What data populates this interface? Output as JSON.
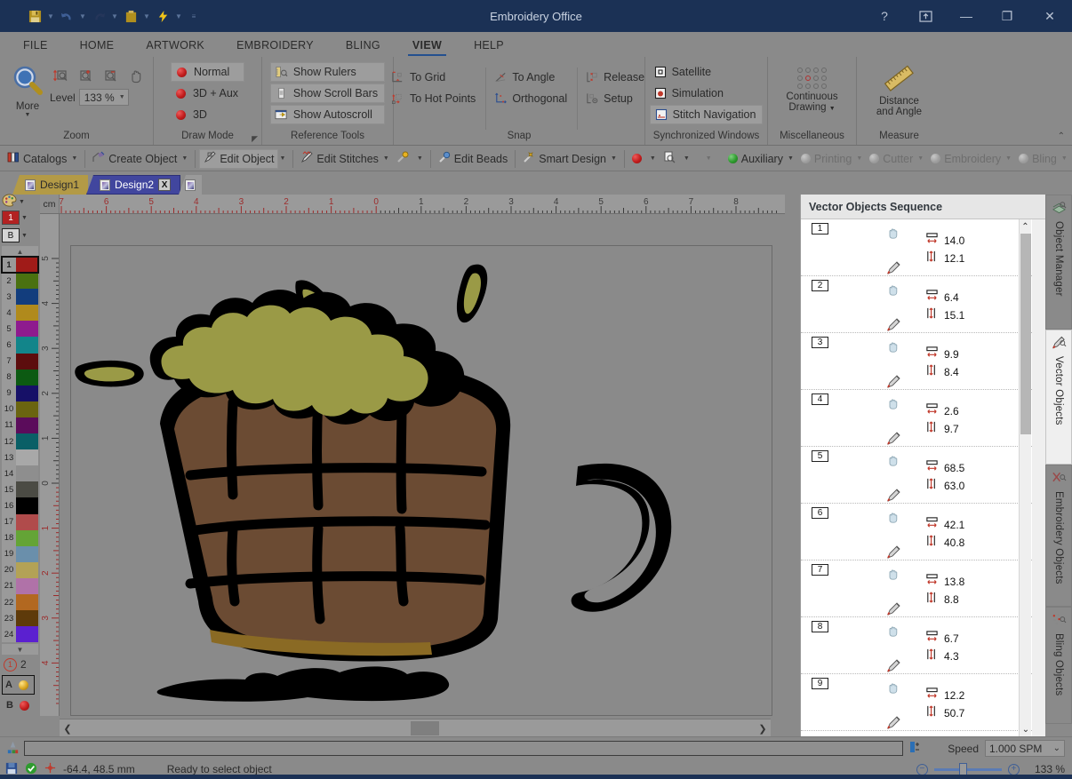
{
  "window": {
    "title": "Embroidery Office",
    "quick_access": [
      "save-icon",
      "undo-icon",
      "redo-icon",
      "clipboard-icon",
      "lightning-icon",
      "more-commands-icon"
    ],
    "buttons": {
      "help": "?",
      "ribbon_display": "⬆",
      "minimize": "—",
      "maximize": "❐",
      "close": "✕"
    }
  },
  "ribbon": {
    "tabs": [
      {
        "label": "FILE",
        "active": false
      },
      {
        "label": "HOME",
        "active": false
      },
      {
        "label": "ARTWORK",
        "active": false
      },
      {
        "label": "EMBROIDERY",
        "active": false
      },
      {
        "label": "BLING",
        "active": false
      },
      {
        "label": "VIEW",
        "active": true
      },
      {
        "label": "HELP",
        "active": false
      }
    ],
    "groups": [
      {
        "name": "Zoom",
        "label": "Zoom",
        "big_button": {
          "label": "More",
          "icon": "magnifier-icon"
        },
        "small_buttons": [
          "zoom-fit-height-icon",
          "zoom-in-icon",
          "zoom-out-icon",
          "pan-hand-icon"
        ],
        "level_label": "Level",
        "level_value": "133 %"
      },
      {
        "name": "DrawMode",
        "label": "Draw Mode",
        "items": [
          {
            "label": "Normal",
            "selected": true
          },
          {
            "label": "3D + Aux",
            "selected": false
          },
          {
            "label": "3D",
            "selected": false
          }
        ],
        "has_dialog_launcher": true
      },
      {
        "name": "ReferenceTools",
        "label": "Reference Tools",
        "items": [
          {
            "label": "Show Rulers",
            "selected": true
          },
          {
            "label": "Show Scroll Bars",
            "selected": true
          },
          {
            "label": "Show Autoscroll",
            "selected": true
          }
        ]
      },
      {
        "name": "Snap",
        "label": "Snap",
        "col1": [
          {
            "label": "To Grid"
          },
          {
            "label": "To Hot Points"
          }
        ],
        "col2": [
          {
            "label": "To Angle"
          },
          {
            "label": "Orthogonal"
          }
        ],
        "col3": [
          {
            "label": "Release"
          },
          {
            "label": "Setup"
          }
        ]
      },
      {
        "name": "SynchronizedWindows",
        "label": "Synchronized Windows",
        "items": [
          {
            "label": "Satellite",
            "selected": false
          },
          {
            "label": "Simulation",
            "selected": false
          },
          {
            "label": "Stitch Navigation",
            "selected": true
          }
        ]
      },
      {
        "name": "Miscellaneous",
        "label": "Miscellaneous",
        "big_button": {
          "label_line1": "Continuous",
          "label_line2": "Drawing",
          "icon": "dot-grid-icon"
        }
      },
      {
        "name": "Measure",
        "label": "Measure",
        "big_button": {
          "label_line1": "Distance",
          "label_line2": "and Angle",
          "icon": "ruler-icon"
        }
      }
    ],
    "collapse_icon": "chevron-up-icon"
  },
  "toolbar2": {
    "items": [
      {
        "label": "Catalogs",
        "icon": "catalogs-icon",
        "arrow": true,
        "selected": false,
        "dim": false
      },
      {
        "label": "Create Object",
        "icon": "create-object-icon",
        "arrow": true,
        "selected": false,
        "dim": false
      },
      {
        "label": "Edit Object",
        "icon": "edit-object-icon",
        "arrow": true,
        "selected": true,
        "dim": false
      },
      {
        "label": "Edit Stitches",
        "icon": "edit-stitches-icon",
        "arrow": true,
        "selected": false,
        "dim": false
      },
      {
        "label": "",
        "icon": "magic-wand-icon",
        "arrow": true,
        "selected": false,
        "dim": false
      },
      {
        "label": "Edit Beads",
        "icon": "edit-beads-icon",
        "arrow": false,
        "selected": false,
        "dim": false
      },
      {
        "label": "Smart Design",
        "icon": "smart-design-icon",
        "arrow": true,
        "selected": false,
        "dim": false
      },
      {
        "label": "",
        "icon": "red-ball-icon",
        "arrow": true,
        "selected": false,
        "dim": false
      },
      {
        "label": "",
        "icon": "inspect-icon",
        "arrow": true,
        "selected": false,
        "dim": false
      },
      {
        "label": "",
        "icon": "blank-icon",
        "arrow": true,
        "selected": false,
        "dim": true
      },
      {
        "label": "Auxiliary",
        "icon": "green-ball-icon",
        "arrow": true,
        "selected": false,
        "dim": false
      },
      {
        "label": "Printing",
        "icon": "grey-ball-icon",
        "arrow": true,
        "selected": false,
        "dim": true
      },
      {
        "label": "Cutter",
        "icon": "grey-ball-icon",
        "arrow": true,
        "selected": false,
        "dim": true
      },
      {
        "label": "Embroidery",
        "icon": "grey-ball-icon",
        "arrow": true,
        "selected": false,
        "dim": true
      },
      {
        "label": "Bling",
        "icon": "grey-ball-icon",
        "arrow": true,
        "selected": false,
        "dim": true
      }
    ]
  },
  "doc_tabs": {
    "tabs": [
      {
        "label": "Design1",
        "active": false,
        "closable": false
      },
      {
        "label": "Design2",
        "active": true,
        "closable": true,
        "close_label": "X"
      }
    ],
    "new_tab_icon": "new-document-icon"
  },
  "palette": {
    "palette_icon": "color-palette-icon",
    "active_index_label": "1",
    "mode_label": "B",
    "scroll_up_icon": "caret-up-icon",
    "scroll_down_icon": "caret-down-icon",
    "swatches": [
      {
        "n": "1",
        "color": "#a01b18"
      },
      {
        "n": "2",
        "color": "#4a7110"
      },
      {
        "n": "3",
        "color": "#123d7d"
      },
      {
        "n": "4",
        "color": "#b08a1c"
      },
      {
        "n": "5",
        "color": "#8e1b8e"
      },
      {
        "n": "6",
        "color": "#12858a"
      },
      {
        "n": "7",
        "color": "#5c0d0d"
      },
      {
        "n": "8",
        "color": "#0c5a12"
      },
      {
        "n": "9",
        "color": "#161067"
      },
      {
        "n": "10",
        "color": "#6a6410"
      },
      {
        "n": "11",
        "color": "#5b0c5b"
      },
      {
        "n": "12",
        "color": "#0a5f66"
      },
      {
        "n": "13",
        "color": "#a8a8a8"
      },
      {
        "n": "14",
        "color": "#8e8e8e"
      },
      {
        "n": "15",
        "color": "#4b4b44"
      },
      {
        "n": "16",
        "color": "#000000"
      },
      {
        "n": "17",
        "color": "#b04b4b"
      },
      {
        "n": "18",
        "color": "#64a436"
      },
      {
        "n": "19",
        "color": "#6a8fab"
      },
      {
        "n": "20",
        "color": "#b3a256"
      },
      {
        "n": "21",
        "color": "#b072a8"
      },
      {
        "n": "22",
        "color": "#b26820"
      },
      {
        "n": "23",
        "color": "#5e3a0a"
      },
      {
        "n": "24",
        "color": "#5b20d0"
      }
    ],
    "needle_group": {
      "num1": "1",
      "num2": "2"
    },
    "needles": [
      {
        "label": "A",
        "color": "#b8902a",
        "selected": true
      },
      {
        "label": "B",
        "color": "#9e1212",
        "selected": false
      }
    ]
  },
  "rulers": {
    "unit": "cm",
    "horizontal_ticks": [
      "7",
      "6",
      "5",
      "4",
      "3",
      "2",
      "1",
      "0",
      "1",
      "2",
      "3",
      "4",
      "5",
      "6",
      "7",
      "8"
    ],
    "vertical_ticks": [
      "5",
      "4",
      "3",
      "2",
      "1",
      "0",
      "1",
      "2",
      "3",
      "4"
    ]
  },
  "dock": {
    "panel_title": "Vector Objects Sequence",
    "scroll_up_icon": "chevron-up-icon",
    "scroll_down_icon": "chevron-down-icon",
    "tabs": [
      {
        "label": "Object Manager",
        "icon": "object-manager-icon",
        "active": false
      },
      {
        "label": "Vector Objects",
        "icon": "vector-objects-icon",
        "active": true
      },
      {
        "label": "Embroidery Objects",
        "icon": "embroidery-objects-icon",
        "active": false
      },
      {
        "label": "Bling Objects",
        "icon": "bling-objects-icon",
        "active": false
      }
    ],
    "objects": [
      {
        "num": "1",
        "width": "14.0",
        "height": "12.1",
        "shape": "blade",
        "color": "#0a0a0a"
      },
      {
        "num": "2",
        "width": "6.4",
        "height": "15.1",
        "shape": "blob",
        "color": "#0a0a0a"
      },
      {
        "num": "3",
        "width": "9.9",
        "height": "8.4",
        "shape": "blade",
        "color": "#ece34a"
      },
      {
        "num": "4",
        "width": "2.6",
        "height": "9.7",
        "shape": "streak",
        "color": "#ece34a"
      },
      {
        "num": "5",
        "width": "68.5",
        "height": "63.0",
        "shape": "cloud",
        "color": "#0a0a0a"
      },
      {
        "num": "6",
        "width": "42.1",
        "height": "40.8",
        "shape": "mug",
        "color": "#b07a4a"
      },
      {
        "num": "7",
        "width": "13.8",
        "height": "8.8",
        "shape": "feather",
        "color": "#0a0a0a"
      },
      {
        "num": "8",
        "width": "6.7",
        "height": "4.3",
        "shape": "slash",
        "color": "#ece34a"
      },
      {
        "num": "9",
        "width": "12.2",
        "height": "50.7",
        "shape": "ground",
        "color": "#0a0a0a"
      }
    ],
    "measure_icons": {
      "width": "width-icon",
      "height": "height-icon"
    },
    "row_icons": {
      "visibility": "visibility-icon",
      "edit": "pencil-icon"
    }
  },
  "simulation_bar": {
    "icon": "simulation-icon",
    "step_icon": "step-icon",
    "play_icon": "play-icon",
    "speed_label": "Speed",
    "speed_value": "1.000 SPM",
    "speed_caret": "⌄"
  },
  "status": {
    "save_icon": "save-icon",
    "ok_icon": "ok-icon",
    "crosshair_icon": "crosshair-icon",
    "coordinates": "-64.4, 48.5 mm",
    "message": "Ready to select object",
    "zoom_out_label": "−",
    "zoom_in_label": "+",
    "zoom_value": "133 %"
  },
  "artwork": {
    "name": "beer-mug-illustration",
    "colors": {
      "outline": "#000000",
      "foam": "#9a9a46",
      "mug": "#6b4b33",
      "mug_base": "#8a6a24"
    }
  }
}
